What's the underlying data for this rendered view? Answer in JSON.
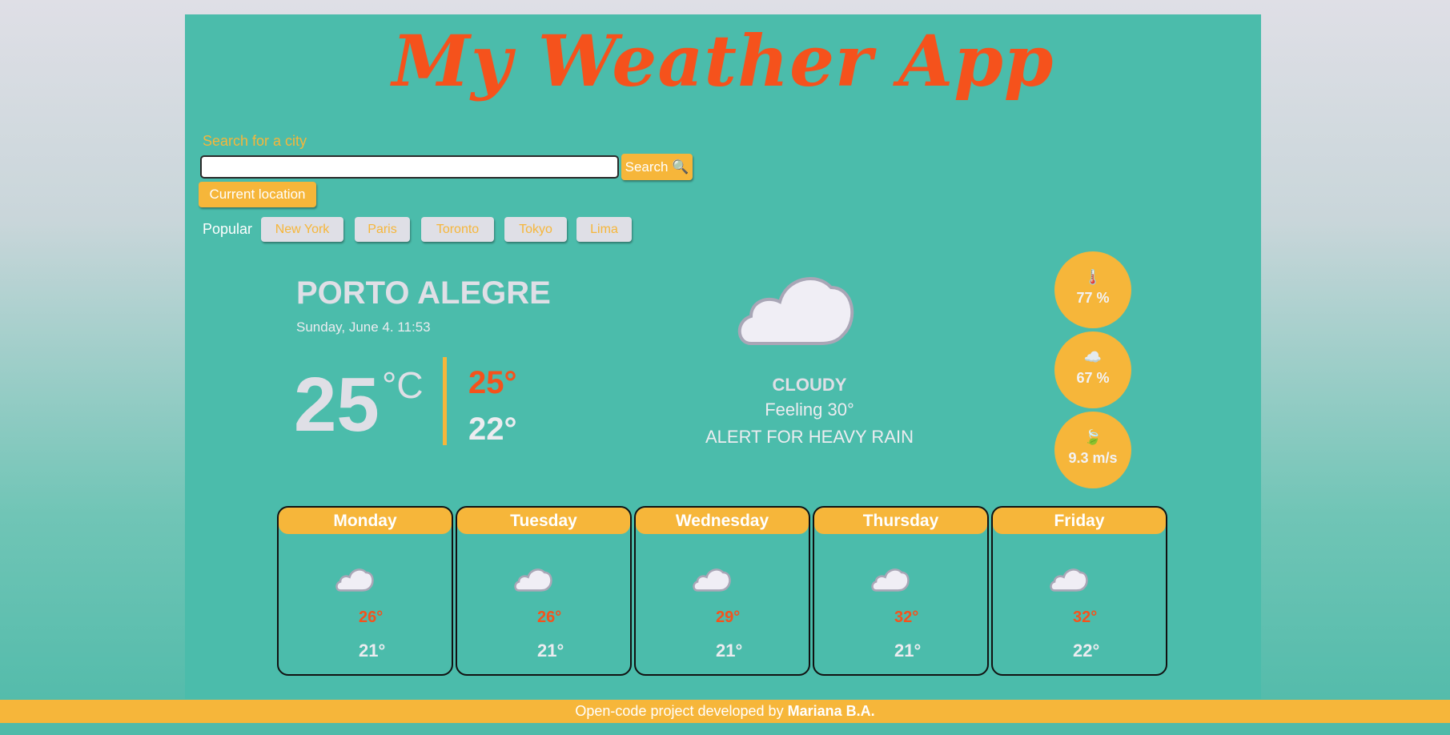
{
  "app": {
    "title": "My Weather App"
  },
  "search": {
    "label": "Search for a city",
    "placeholder": "",
    "value": "",
    "button_label": "Search 🔍",
    "current_location_label": "Current location"
  },
  "popular": {
    "label": "Popular",
    "cities": [
      "New York",
      "Paris",
      "Toronto",
      "Tokyo",
      "Lima"
    ]
  },
  "current": {
    "city": "PORTO ALEGRE",
    "date": "Sunday, June 4. 11:53",
    "temperature": "25",
    "unit": "°C",
    "max": "25°",
    "min": "22°",
    "icon": "cloud-icon",
    "condition": "CLOUDY",
    "feeling": "Feeling 30°",
    "alert": "ALERT FOR HEAVY RAIN"
  },
  "stats": [
    {
      "icon": "thermometer-icon",
      "glyph": "🌡️",
      "value": "77 %"
    },
    {
      "icon": "cloud-icon",
      "glyph": "☁️",
      "value": "67 %"
    },
    {
      "icon": "leaf-wind-icon",
      "glyph": "🍃",
      "value": "9.3 m/s"
    }
  ],
  "forecast": [
    {
      "day": "Monday",
      "icon": "cloud-icon",
      "max": "26°",
      "min": "21°"
    },
    {
      "day": "Tuesday",
      "icon": "cloud-icon",
      "max": "26°",
      "min": "21°"
    },
    {
      "day": "Wednesday",
      "icon": "cloud-icon",
      "max": "29°",
      "min": "21°"
    },
    {
      "day": "Thursday",
      "icon": "cloud-icon",
      "max": "32°",
      "min": "21°"
    },
    {
      "day": "Friday",
      "icon": "cloud-icon",
      "max": "32°",
      "min": "22°"
    }
  ],
  "footer": {
    "text": "Open-code project developed by ",
    "author": "Mariana B.A."
  },
  "colors": {
    "background": "#4bbcab",
    "accent": "#f6b63a",
    "title": "#f5521c",
    "max_temp": "#f5521c"
  }
}
